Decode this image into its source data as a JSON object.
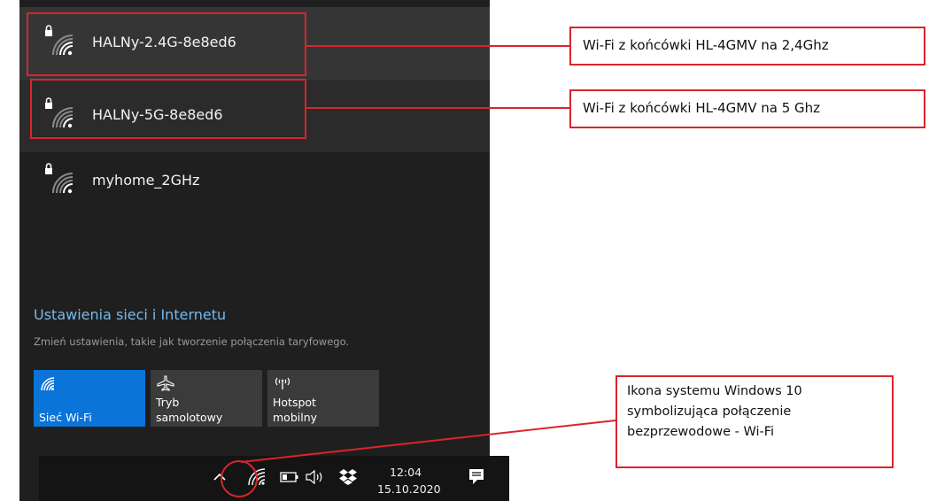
{
  "networks": [
    {
      "name": "HALNy-2.4G-8e8ed6",
      "secured": true
    },
    {
      "name": "HALNy-5G-8e8ed6",
      "secured": true
    },
    {
      "name": "myhome_2GHz",
      "secured": true
    }
  ],
  "settings": {
    "link": "Ustawienia sieci i Internetu",
    "description": "Zmień ustawienia, takie jak tworzenie połączenia taryfowego."
  },
  "quick_actions": [
    {
      "icon": "wifi-icon",
      "label_lines": [
        "",
        "Sieć Wi-Fi"
      ],
      "active": true
    },
    {
      "icon": "airplane-icon",
      "label_lines": [
        "Tryb",
        "samolotowy"
      ],
      "active": false
    },
    {
      "icon": "hotspot-icon",
      "label_lines": [
        "Hotspot",
        "mobilny"
      ],
      "active": false
    }
  ],
  "taskbar": {
    "icons": [
      "chevron-up-icon",
      "wifi-icon",
      "battery-icon",
      "volume-icon",
      "dropbox-icon",
      "action-center-icon"
    ],
    "time": "12:04",
    "date": "15.10.2020"
  },
  "annotations": {
    "callout_24": "Wi-Fi z końcówki HL-4GMV na 2,4Ghz",
    "callout_5": "Wi-Fi z końcówki HL-4GMV na 5 Ghz",
    "callout_taskbar": [
      "Ikona systemu Windows 10",
      "symbolizująca połączenie",
      "bezprzewodowe - Wi-Fi"
    ]
  },
  "colors": {
    "flyout_bg": "#1f1f1f",
    "accent": "#0a74d9",
    "link": "#76b9ed",
    "annotation_red": "#d9252c"
  }
}
